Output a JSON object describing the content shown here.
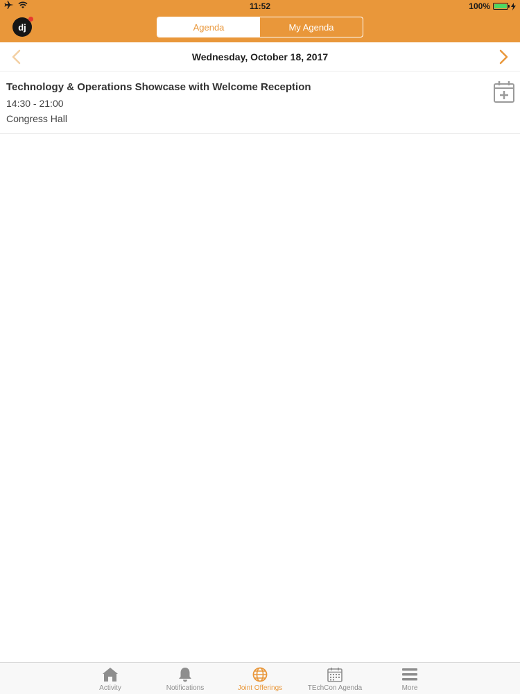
{
  "status_bar": {
    "time": "11:52",
    "battery": "100%"
  },
  "header": {
    "logo_text": "dj",
    "tabs": [
      {
        "label": "Agenda",
        "active": true
      },
      {
        "label": "My Agenda",
        "active": false
      }
    ]
  },
  "date_nav": {
    "date": "Wednesday, October 18, 2017"
  },
  "agenda": {
    "items": [
      {
        "title": "Technology & Operations Showcase with Welcome Reception",
        "time": "14:30 - 21:00",
        "location": "Congress Hall"
      }
    ]
  },
  "tab_bar": {
    "items": [
      {
        "label": "Activity",
        "icon": "home-icon",
        "active": false
      },
      {
        "label": "Notifications",
        "icon": "bell-icon",
        "active": false
      },
      {
        "label": "Joint Offerings",
        "icon": "globe-icon",
        "active": true
      },
      {
        "label": "TEchCon Agenda",
        "icon": "calendar-icon",
        "active": false
      },
      {
        "label": "More",
        "icon": "menu-icon",
        "active": false
      }
    ]
  },
  "colors": {
    "accent": "#e9973a",
    "tab_inactive": "#8e8e8e"
  }
}
